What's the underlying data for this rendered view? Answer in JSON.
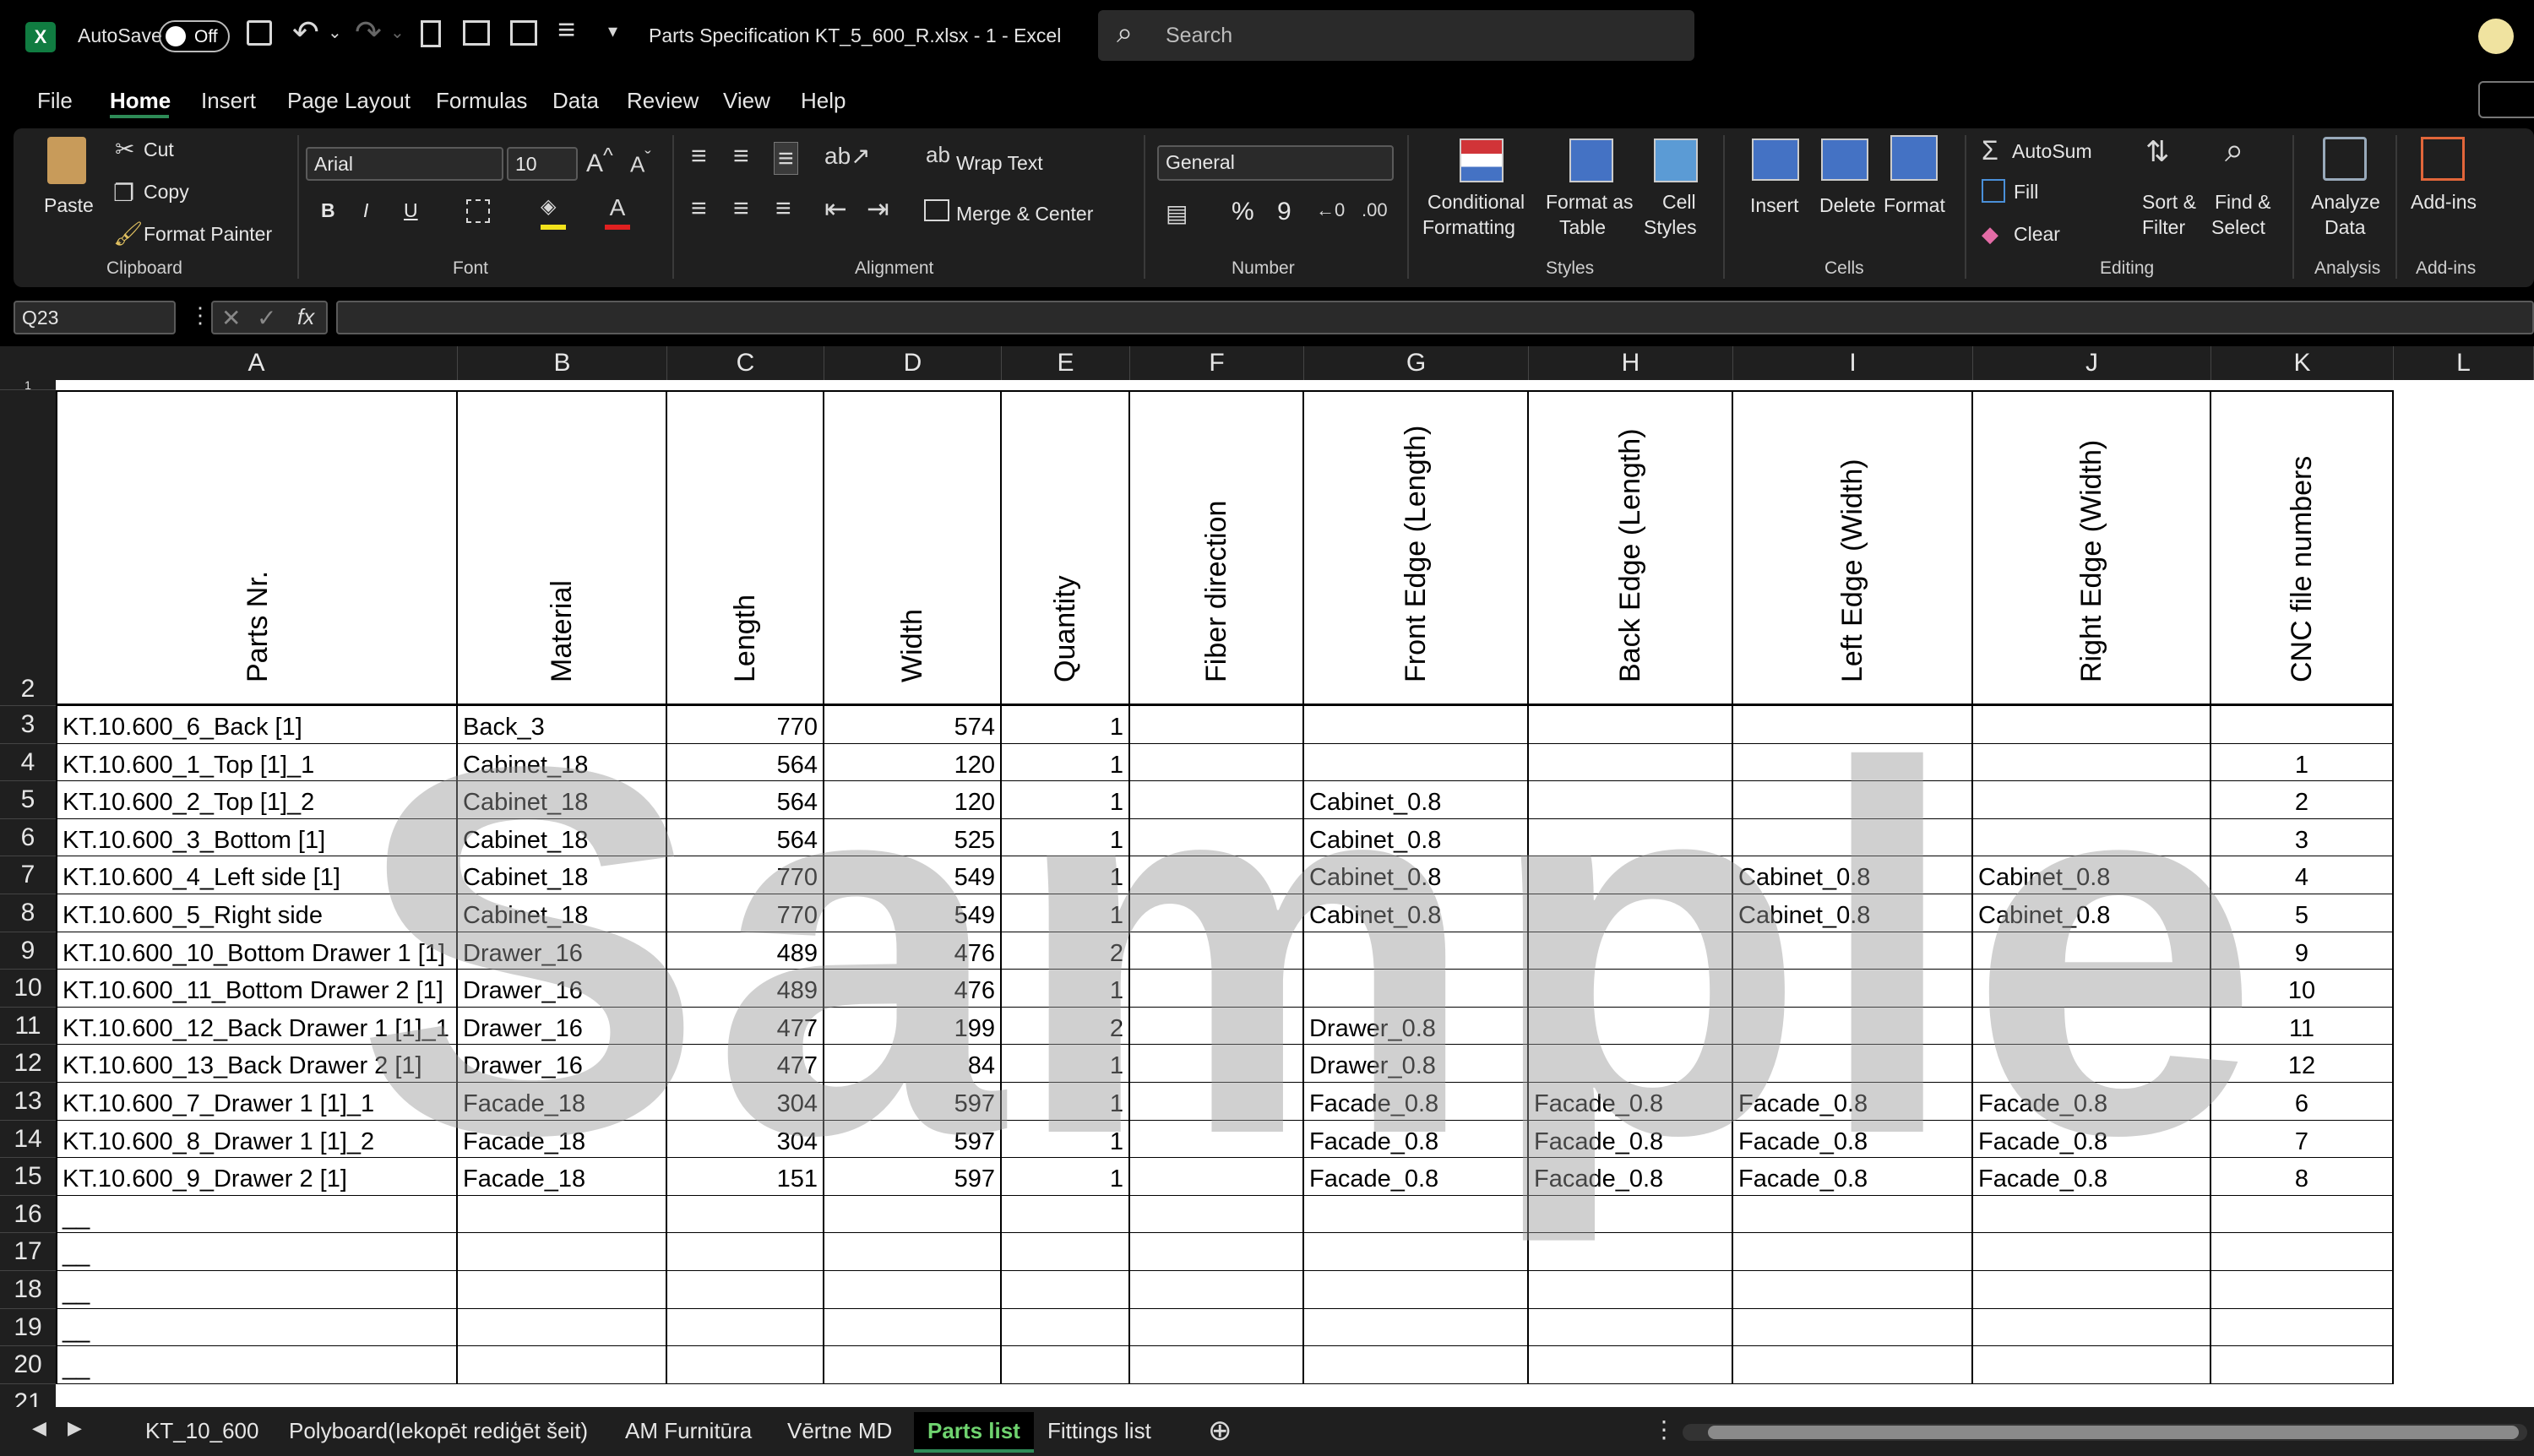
{
  "title_bar": {
    "autosave_label": "AutoSave",
    "autosave_state": "Off",
    "filename": "Parts Specification KT_5_600_R.xlsx  -  1  -  Excel",
    "search_placeholder": "Search"
  },
  "menu": [
    "File",
    "Home",
    "Insert",
    "Page Layout",
    "Formulas",
    "Data",
    "Review",
    "View",
    "Help"
  ],
  "ribbon": {
    "clipboard": {
      "paste": "Paste",
      "cut": "Cut",
      "copy": "Copy",
      "format_painter": "Format Painter",
      "group": "Clipboard"
    },
    "font": {
      "name": "Arial",
      "size": "10",
      "bold": "B",
      "italic": "I",
      "underline": "U",
      "group": "Font"
    },
    "alignment": {
      "wrap": "Wrap Text",
      "merge": "Merge & Center",
      "group": "Alignment"
    },
    "number": {
      "format": "General",
      "percent": "%",
      "comma": "9",
      "group": "Number"
    },
    "styles": {
      "conditional": "Conditional",
      "conditional2": "Formatting",
      "format_table": "Format as",
      "format_table2": "Table",
      "cell_styles": "Cell",
      "cell_styles2": "Styles",
      "group": "Styles"
    },
    "cells": {
      "insert": "Insert",
      "delete": "Delete",
      "format": "Format",
      "group": "Cells"
    },
    "editing": {
      "autosum": "AutoSum",
      "fill": "Fill",
      "clear": "Clear",
      "sort": "Sort &",
      "sort2": "Filter",
      "find": "Find &",
      "find2": "Select",
      "group": "Editing"
    },
    "analysis": {
      "analyze": "Analyze",
      "analyze2": "Data",
      "group": "Analysis"
    },
    "addins": {
      "label": "Add-ins",
      "group": "Add-ins"
    }
  },
  "formula_bar": {
    "name_box": "Q23",
    "fx": "fx",
    "value": ""
  },
  "columns": [
    "A",
    "B",
    "C",
    "D",
    "E",
    "F",
    "G",
    "H",
    "I",
    "J",
    "K",
    "L"
  ],
  "header_row": {
    "row": "2",
    "labels": [
      "Parts Nr.",
      "Material",
      "Length",
      "Width",
      "Quantity",
      "Fiber direction",
      "Front Edge (Length)",
      "Back Edge (Length)",
      "Left Edge (Width)",
      "Right Edge (Width)",
      "CNC  file numbers"
    ]
  },
  "rows": [
    {
      "n": "3",
      "cells": [
        "KT.10.600_6_Back [1]",
        "Back_3",
        "770",
        "574",
        "1",
        "",
        "",
        "",
        "",
        "",
        ""
      ]
    },
    {
      "n": "4",
      "cells": [
        "KT.10.600_1_Top [1]_1",
        "Cabinet_18",
        "564",
        "120",
        "1",
        "",
        "",
        "",
        "",
        "",
        "1"
      ]
    },
    {
      "n": "5",
      "cells": [
        "KT.10.600_2_Top [1]_2",
        "Cabinet_18",
        "564",
        "120",
        "1",
        "",
        "Cabinet_0.8",
        "",
        "",
        "",
        "2"
      ]
    },
    {
      "n": "6",
      "cells": [
        "KT.10.600_3_Bottom [1]",
        "Cabinet_18",
        "564",
        "525",
        "1",
        "",
        "Cabinet_0.8",
        "",
        "",
        "",
        "3"
      ]
    },
    {
      "n": "7",
      "cells": [
        "KT.10.600_4_Left side [1]",
        "Cabinet_18",
        "770",
        "549",
        "1",
        "",
        "Cabinet_0.8",
        "",
        "Cabinet_0.8",
        "Cabinet_0.8",
        "4"
      ]
    },
    {
      "n": "8",
      "cells": [
        "KT.10.600_5_Right side",
        "Cabinet_18",
        "770",
        "549",
        "1",
        "",
        "Cabinet_0.8",
        "",
        "Cabinet_0.8",
        "Cabinet_0.8",
        "5"
      ]
    },
    {
      "n": "9",
      "cells": [
        "KT.10.600_10_Bottom Drawer 1 [1]",
        "Drawer_16",
        "489",
        "476",
        "2",
        "",
        "",
        "",
        "",
        "",
        "9"
      ]
    },
    {
      "n": "10",
      "cells": [
        "KT.10.600_11_Bottom Drawer 2 [1]",
        "Drawer_16",
        "489",
        "476",
        "1",
        "",
        "",
        "",
        "",
        "",
        "10"
      ]
    },
    {
      "n": "11",
      "cells": [
        "KT.10.600_12_Back Drawer 1 [1]_1",
        "Drawer_16",
        "477",
        "199",
        "2",
        "",
        "Drawer_0.8",
        "",
        "",
        "",
        "11"
      ]
    },
    {
      "n": "12",
      "cells": [
        "KT.10.600_13_Back Drawer 2 [1]",
        "Drawer_16",
        "477",
        "84",
        "1",
        "",
        "Drawer_0.8",
        "",
        "",
        "",
        "12"
      ]
    },
    {
      "n": "13",
      "cells": [
        "KT.10.600_7_Drawer 1 [1]_1",
        "Facade_18",
        "304",
        "597",
        "1",
        "",
        "Facade_0.8",
        "Facade_0.8",
        "Facade_0.8",
        "Facade_0.8",
        "6"
      ]
    },
    {
      "n": "14",
      "cells": [
        "KT.10.600_8_Drawer 1 [1]_2",
        "Facade_18",
        "304",
        "597",
        "1",
        "",
        "Facade_0.8",
        "Facade_0.8",
        "Facade_0.8",
        "Facade_0.8",
        "7"
      ]
    },
    {
      "n": "15",
      "cells": [
        "KT.10.600_9_Drawer 2 [1]",
        "Facade_18",
        "151",
        "597",
        "1",
        "",
        "Facade_0.8",
        "Facade_0.8",
        "Facade_0.8",
        "Facade_0.8",
        "8"
      ]
    },
    {
      "n": "16",
      "cells": [
        "__",
        "",
        "",
        "",
        "",
        "",
        "",
        "",
        "",
        "",
        ""
      ]
    },
    {
      "n": "17",
      "cells": [
        "__",
        "",
        "",
        "",
        "",
        "",
        "",
        "",
        "",
        "",
        ""
      ]
    },
    {
      "n": "18",
      "cells": [
        "__",
        "",
        "",
        "",
        "",
        "",
        "",
        "",
        "",
        "",
        ""
      ]
    },
    {
      "n": "19",
      "cells": [
        "__",
        "",
        "",
        "",
        "",
        "",
        "",
        "",
        "",
        "",
        ""
      ]
    },
    {
      "n": "20",
      "cells": [
        "__",
        "",
        "",
        "",
        "",
        "",
        "",
        "",
        "",
        "",
        ""
      ]
    }
  ],
  "extra_rows": [
    "1",
    "21"
  ],
  "watermark": "Sample",
  "sheet_tabs": [
    "KT_10_600",
    "Polyboard(Iekopēt rediģēt šeit)",
    "AM Furnitūra",
    "Vērtne  MD",
    "Parts list",
    "Fittings list"
  ],
  "active_tab": "Parts list",
  "colors": {
    "accent_green": "#2e8b57",
    "excel_icon": "#107c41",
    "active_tab_text": "#6fd36f"
  }
}
